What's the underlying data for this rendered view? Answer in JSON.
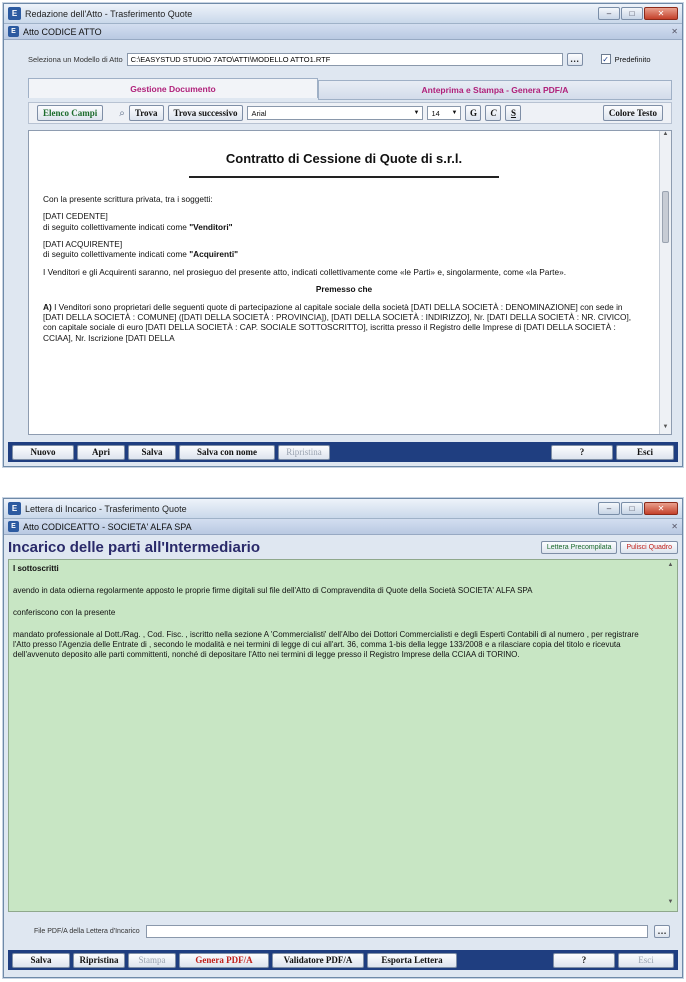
{
  "window1": {
    "title": "Redazione dell'Atto - Trasferimento Quote",
    "subtitle": "Atto CODICE ATTO",
    "model_label": "Seleziona un Modello di Atto",
    "model_value": "C:\\EASYSTUD STUDIO 7ATO\\ATTI\\MODELLO ATTO1.RTF",
    "predefinito_label": "Predefinito",
    "tabs": [
      "Gestione Documento",
      "Anteprima e Stampa - Genera PDF/A"
    ],
    "toolbar": {
      "elenco": "Elenco Campi",
      "trova": "Trova",
      "trova_succ": "Trova successivo",
      "font": "Arial",
      "size": "14",
      "bold": "G",
      "italic": "C",
      "underline": "S",
      "colore": "Colore Testo"
    },
    "document": {
      "title": "Contratto di Cessione di Quote di s.r.l.",
      "p1": "Con la presente scrittura privata, tra i soggetti:",
      "p2a": "[DATI CEDENTE]",
      "p2b": "di seguito collettivamente indicati come ",
      "p2c": "\"Venditori\"",
      "p3a": "[DATI ACQUIRENTE]",
      "p3b": "di seguito collettivamente indicati come ",
      "p3c": "\"Acquirenti\"",
      "p4": "I Venditori e gli Acquirenti saranno, nel prosieguo del presente atto, indicati collettivamente come «le Parti» e, singolarmente, come «la Parte».",
      "section": "Premesso che",
      "p5a": "A) ",
      "p5": "I Venditori sono proprietari delle seguenti quote di partecipazione al capitale sociale della società [DATI DELLA SOCIETÀ : DENOMINAZIONE] con sede in [DATI DELLA SOCIETÀ : COMUNE] ([DATI DELLA SOCIETÀ : PROVINCIA]), [DATI DELLA SOCIETÀ : INDIRIZZO], Nr. [DATI DELLA SOCIETÀ : NR. CIVICO], con capitale sociale di euro [DATI DELLA SOCIETÀ : CAP. SOCIALE SOTTOSCRITTO], iscritta presso il Registro delle Imprese di [DATI DELLA SOCIETÀ : CCIAA], Nr. Iscrizione [DATI DELLA"
    },
    "footer": {
      "nuovo": "Nuovo",
      "apri": "Apri",
      "salva": "Salva",
      "salva_nome": "Salva con nome",
      "ripristina": "Ripristina",
      "help": "?",
      "esci": "Esci"
    }
  },
  "window2": {
    "title": "Lettera di Incarico - Trasferimento Quote",
    "subtitle": "Atto CODICEATTO - SOCIETA' ALFA SPA",
    "heading": "Incarico delle parti all'Intermediario",
    "btn_precompilata": "Lettera Precompilata",
    "btn_pulisci": "Pulisci Quadro",
    "letter": {
      "p1": "I sottoscritti",
      "p2": "avendo in data odierna regolarmente apposto le proprie firme digitali sul file dell'Atto di Compravendita di Quote della Società SOCIETA' ALFA SPA",
      "p3": "conferiscono con la presente",
      "p4": "mandato professionale al Dott./Rag. , Cod. Fisc. , iscritto nella sezione A 'Commercialisti' dell'Albo dei Dottori Commercialisti e degli Esperti Contabili di al numero , per registrare l'Atto presso l'Agenzia delle Entrate di , secondo le modalità e nei termini di legge di cui all'art. 36, comma 1-bis della legge 133/2008 e a rilasciare copia del titolo e ricevuta dell'avvenuto deposito alle parti committenti, nonché di depositare l'Atto nei termini di legge presso il Registro Imprese della CCIAA di TORINO."
    },
    "pdf_label": "File PDF/A della Lettera d'Incarico",
    "pdf_value": "",
    "footer": {
      "salva": "Salva",
      "ripristina": "Ripristina",
      "stampa": "Stampa",
      "genera": "Genera PDF/A",
      "validatore": "Validatore PDF/A",
      "esporta": "Esporta Lettera",
      "help": "?",
      "esci": "Esci"
    }
  },
  "colors": {
    "accent": "#1f3e80",
    "letter_bg": "#c8e6c4",
    "heading": "#2a2a6a",
    "tab_text": "#b0207a"
  }
}
